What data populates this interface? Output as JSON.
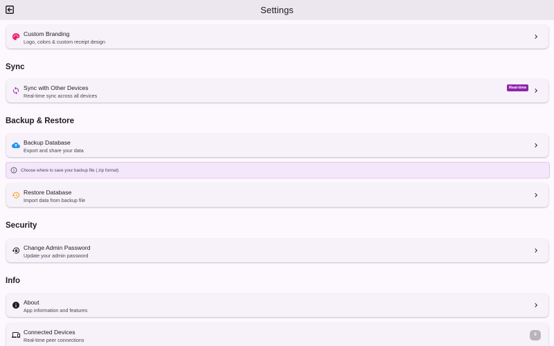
{
  "appbar": {
    "title": "Settings"
  },
  "branding": {
    "title": "Custom Branding",
    "subtitle": "Logo, colors & custom receipt design",
    "icon": "palette-icon",
    "icon_color": "#e91e63"
  },
  "sync_section": {
    "title": "Sync"
  },
  "sync_item": {
    "title": "Sync with Other Devices",
    "subtitle": "Real-time sync across all devices",
    "badge": "Real-time",
    "icon": "sync-icon",
    "icon_color": "#9c27b0",
    "badge_color": "#8e24aa"
  },
  "backup_section": {
    "title": "Backup & Restore"
  },
  "backup_item": {
    "title": "Backup Database",
    "subtitle": "Export and share your data",
    "icon": "cloud-upload-icon",
    "icon_color": "#2196f3"
  },
  "backup_info": {
    "text": "Choose where to save your backup file (.zip format)",
    "icon": "info-icon"
  },
  "restore_item": {
    "title": "Restore Database",
    "subtitle": "Import data from backup file",
    "icon": "restore-icon",
    "icon_color": "#ff9800"
  },
  "security_section": {
    "title": "Security"
  },
  "password_item": {
    "title": "Change Admin Password",
    "subtitle": "Update your admin password",
    "icon": "lock-reset-icon"
  },
  "info_section": {
    "title": "Info"
  },
  "about_item": {
    "title": "About",
    "subtitle": "App information and features",
    "icon": "info-filled-icon"
  },
  "devices_item": {
    "title": "Connected Devices",
    "subtitle": "Real-time peer connections",
    "count": "0",
    "icon": "devices-icon"
  }
}
